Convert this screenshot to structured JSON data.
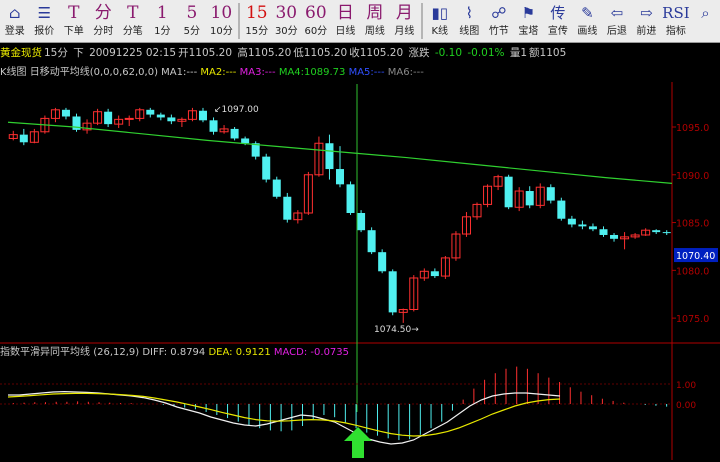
{
  "toolbar": [
    {
      "big": "⌂",
      "label": "登录",
      "kind": "ico",
      "name": "login-button"
    },
    {
      "big": "☰",
      "label": "报价",
      "kind": "ico",
      "name": "quote-button"
    },
    {
      "big": "T",
      "label": "下单",
      "kind": "",
      "name": "order-button"
    },
    {
      "big": "分",
      "label": "分时",
      "kind": "",
      "name": "timeshare-button"
    },
    {
      "big": "T",
      "label": "分笔",
      "kind": "",
      "name": "tick-button"
    },
    {
      "big": "1",
      "label": "1分",
      "kind": "",
      "name": "period-1m-button"
    },
    {
      "big": "5",
      "label": "5分",
      "kind": "",
      "name": "period-5m-button"
    },
    {
      "big": "10",
      "label": "10分",
      "kind": "",
      "name": "period-10m-button"
    },
    {
      "big": "15",
      "label": "15分",
      "kind": "red",
      "name": "period-15m-button"
    },
    {
      "big": "30",
      "label": "30分",
      "kind": "",
      "name": "period-30m-button"
    },
    {
      "big": "60",
      "label": "60分",
      "kind": "",
      "name": "period-60m-button"
    },
    {
      "big": "日",
      "label": "日线",
      "kind": "",
      "name": "period-day-button"
    },
    {
      "big": "周",
      "label": "周线",
      "kind": "",
      "name": "period-week-button"
    },
    {
      "big": "月",
      "label": "月线",
      "kind": "",
      "name": "period-month-button"
    },
    {
      "big": "▮▯",
      "label": "K线",
      "kind": "ico",
      "name": "kline-button"
    },
    {
      "big": "⌇",
      "label": "线图",
      "kind": "ico",
      "name": "line-chart-button"
    },
    {
      "big": "☍",
      "label": "竹节",
      "kind": "ico",
      "name": "bamboo-button"
    },
    {
      "big": "⚑",
      "label": "宝塔",
      "kind": "ico",
      "name": "tower-button"
    },
    {
      "big": "传",
      "label": "宣传",
      "kind": "ico",
      "name": "promo-button"
    },
    {
      "big": "✎",
      "label": "画线",
      "kind": "ico",
      "name": "draw-line-button"
    },
    {
      "big": "⇦",
      "label": "后退",
      "kind": "ico",
      "name": "back-button"
    },
    {
      "big": "⇨",
      "label": "前进",
      "kind": "ico",
      "name": "forward-button"
    },
    {
      "big": "RSI",
      "label": "指标",
      "kind": "ico",
      "name": "indicator-button"
    },
    {
      "big": "⌕",
      "label": "",
      "kind": "ico",
      "name": "search-button"
    }
  ],
  "info": {
    "name": "黄金现货",
    "period": "15分",
    "dir": "下",
    "datetime": "20091225 02:15",
    "open": "开1105.20",
    "high": "高1105.20",
    "low": "低1105.20",
    "close": "收1105.20",
    "trend": "涨跌",
    "change": "-0.10",
    "pct": "-0.01%",
    "vol": "量1",
    "amount": "额1105"
  },
  "ma": {
    "label": "K线图 日移动平均线",
    "params": "(0,0,0,62,0,0)",
    "ma1": "MA1:---",
    "ma2": "MA2:---",
    "ma3": "MA3:---",
    "ma4": "MA4:1089.73",
    "ma5": "MA5:---",
    "ma6": "MA6:---"
  },
  "macd": {
    "label": "指数平滑异同平均线",
    "params": "(26,12,9)",
    "diff": "DIFF: 0.8794",
    "dea": "DEA: 0.9121",
    "macd": "MACD: -0.0735"
  },
  "annotations": {
    "high": "1097.00",
    "low": "1074.50"
  },
  "axis": {
    "labels": [
      "1095.0",
      "1090.0",
      "1085.0",
      "1080.0",
      "1075.0"
    ],
    "current": "1070.40",
    "macd_labels": [
      "1.00",
      "0.00"
    ]
  },
  "chart_data": {
    "type": "candlestick",
    "series_ma": "MA4",
    "candles": [
      [
        1093.8,
        1094.6,
        1093.6,
        1094.2
      ],
      [
        1094.2,
        1094.8,
        1093.1,
        1093.4
      ],
      [
        1093.4,
        1094.8,
        1093.3,
        1094.5
      ],
      [
        1094.5,
        1096.2,
        1094.3,
        1095.9
      ],
      [
        1095.9,
        1097.0,
        1095.5,
        1096.8
      ],
      [
        1096.8,
        1097.0,
        1095.8,
        1096.1
      ],
      [
        1096.1,
        1096.4,
        1094.5,
        1094.7
      ],
      [
        1094.7,
        1095.8,
        1094.3,
        1095.4
      ],
      [
        1095.4,
        1096.9,
        1095.2,
        1096.6
      ],
      [
        1096.6,
        1096.9,
        1095.0,
        1095.3
      ],
      [
        1095.3,
        1096.2,
        1094.9,
        1095.8
      ],
      [
        1095.8,
        1096.2,
        1095.1,
        1095.9
      ],
      [
        1095.9,
        1097.0,
        1095.6,
        1096.8
      ],
      [
        1096.8,
        1097.0,
        1096.0,
        1096.3
      ],
      [
        1096.3,
        1096.5,
        1095.7,
        1096.0
      ],
      [
        1096.0,
        1096.3,
        1095.3,
        1095.6
      ],
      [
        1095.6,
        1096.0,
        1095.0,
        1095.8
      ],
      [
        1095.8,
        1097.0,
        1095.6,
        1096.7
      ],
      [
        1096.7,
        1097.0,
        1095.5,
        1095.7
      ],
      [
        1095.7,
        1096.0,
        1094.2,
        1094.5
      ],
      [
        1094.5,
        1095.2,
        1094.3,
        1094.8
      ],
      [
        1094.8,
        1095.0,
        1093.6,
        1093.8
      ],
      [
        1093.8,
        1094.0,
        1093.1,
        1093.3
      ],
      [
        1093.3,
        1093.5,
        1091.6,
        1091.9
      ],
      [
        1091.9,
        1092.2,
        1089.2,
        1089.5
      ],
      [
        1089.5,
        1089.8,
        1087.5,
        1087.7
      ],
      [
        1087.7,
        1088.1,
        1085.0,
        1085.3
      ],
      [
        1085.3,
        1086.3,
        1084.9,
        1086.0
      ],
      [
        1086.0,
        1090.3,
        1085.8,
        1090.0
      ],
      [
        1090.0,
        1094.0,
        1089.8,
        1093.3
      ],
      [
        1093.3,
        1094.2,
        1089.5,
        1090.6
      ],
      [
        1090.6,
        1093.0,
        1088.7,
        1089.0
      ],
      [
        1089.0,
        1089.3,
        1085.8,
        1086.0
      ],
      [
        1086.0,
        1086.3,
        1084.0,
        1084.2
      ],
      [
        1084.2,
        1084.5,
        1081.7,
        1081.9
      ],
      [
        1081.9,
        1082.2,
        1079.7,
        1079.9
      ],
      [
        1079.9,
        1080.1,
        1075.3,
        1075.6
      ],
      [
        1075.6,
        1076.0,
        1074.5,
        1075.9
      ],
      [
        1075.9,
        1079.5,
        1075.7,
        1079.2
      ],
      [
        1079.2,
        1080.2,
        1078.9,
        1079.9
      ],
      [
        1079.9,
        1080.2,
        1079.2,
        1079.4
      ],
      [
        1079.4,
        1081.5,
        1079.1,
        1081.3
      ],
      [
        1081.3,
        1084.1,
        1081.0,
        1083.8
      ],
      [
        1083.8,
        1086.1,
        1083.5,
        1085.6
      ],
      [
        1085.6,
        1087.1,
        1085.3,
        1086.9
      ],
      [
        1086.9,
        1089.0,
        1086.6,
        1088.8
      ],
      [
        1088.8,
        1090.0,
        1088.4,
        1089.8
      ],
      [
        1089.8,
        1090.0,
        1086.4,
        1086.6
      ],
      [
        1086.6,
        1088.7,
        1086.2,
        1088.3
      ],
      [
        1088.3,
        1088.8,
        1086.5,
        1086.8
      ],
      [
        1086.8,
        1089.1,
        1086.5,
        1088.7
      ],
      [
        1088.7,
        1089.0,
        1087.0,
        1087.3
      ],
      [
        1087.3,
        1087.6,
        1085.2,
        1085.4
      ],
      [
        1085.4,
        1085.7,
        1084.5,
        1084.8
      ],
      [
        1084.8,
        1085.2,
        1084.3,
        1084.6
      ],
      [
        1084.6,
        1084.9,
        1084.1,
        1084.3
      ],
      [
        1084.3,
        1084.6,
        1083.5,
        1083.7
      ],
      [
        1083.7,
        1083.9,
        1083.0,
        1083.3
      ],
      [
        1083.3,
        1084.0,
        1082.2,
        1083.5
      ],
      [
        1083.5,
        1083.9,
        1083.3,
        1083.7
      ],
      [
        1083.7,
        1084.4,
        1083.6,
        1084.2
      ],
      [
        1084.2,
        1084.3,
        1083.8,
        1084.0
      ],
      [
        1084.0,
        1084.2,
        1083.7,
        1083.9
      ]
    ],
    "ma4": [
      1095.5,
      1095.0,
      1094.3,
      1093.6,
      1093.0,
      1092.4,
      1091.8,
      1091.1,
      1090.4,
      1089.7,
      1089.1
    ],
    "macd_hist": [
      0.02,
      0.03,
      0.04,
      0.04,
      0.05,
      0.05,
      0.06,
      0.05,
      0.04,
      0.03,
      0.02,
      0.02,
      0.01,
      0.0,
      -0.02,
      -0.05,
      -0.08,
      -0.12,
      -0.18,
      -0.25,
      -0.32,
      -0.4,
      -0.48,
      -0.55,
      -0.6,
      -0.62,
      -0.6,
      -0.5,
      -0.35,
      -0.25,
      -0.3,
      -0.42,
      -0.55,
      -0.65,
      -0.72,
      -0.78,
      -0.82,
      -0.8,
      -0.7,
      -0.55,
      -0.4,
      -0.15,
      0.1,
      0.35,
      0.55,
      0.7,
      0.8,
      0.85,
      0.8,
      0.7,
      0.6,
      0.5,
      0.38,
      0.28,
      0.2,
      0.12,
      0.07,
      0.03,
      0.0,
      -0.02,
      -0.04,
      -0.06
    ],
    "diff": [
      0.45,
      0.45,
      0.5,
      0.55,
      0.6,
      0.62,
      0.6,
      0.58,
      0.55,
      0.5,
      0.45,
      0.4,
      0.32,
      0.2,
      0.05,
      -0.15,
      -0.3,
      -0.45,
      -0.65,
      -0.8,
      -0.95,
      -1.05,
      -1.1,
      -1.0,
      -0.85,
      -0.7,
      -0.55,
      -0.6,
      -0.75,
      -0.9,
      -1.2,
      -1.5,
      -1.75,
      -1.9,
      -2.0,
      -1.95,
      -1.8,
      -1.5,
      -1.2,
      -0.9,
      -0.5,
      -0.1,
      0.2,
      0.4,
      0.5,
      0.55,
      0.55,
      0.5,
      0.45,
      0.4
    ],
    "dea": [
      0.35,
      0.38,
      0.42,
      0.46,
      0.5,
      0.52,
      0.53,
      0.53,
      0.52,
      0.5,
      0.47,
      0.43,
      0.38,
      0.3,
      0.2,
      0.1,
      -0.02,
      -0.15,
      -0.28,
      -0.42,
      -0.55,
      -0.68,
      -0.78,
      -0.84,
      -0.86,
      -0.84,
      -0.8,
      -0.78,
      -0.8,
      -0.85,
      -0.95,
      -1.08,
      -1.22,
      -1.36,
      -1.48,
      -1.56,
      -1.6,
      -1.58,
      -1.5,
      -1.38,
      -1.2,
      -0.98,
      -0.75,
      -0.5,
      -0.3,
      -0.1,
      0.05,
      0.15,
      0.22,
      0.25
    ],
    "ylim": [
      1072,
      1100
    ]
  }
}
